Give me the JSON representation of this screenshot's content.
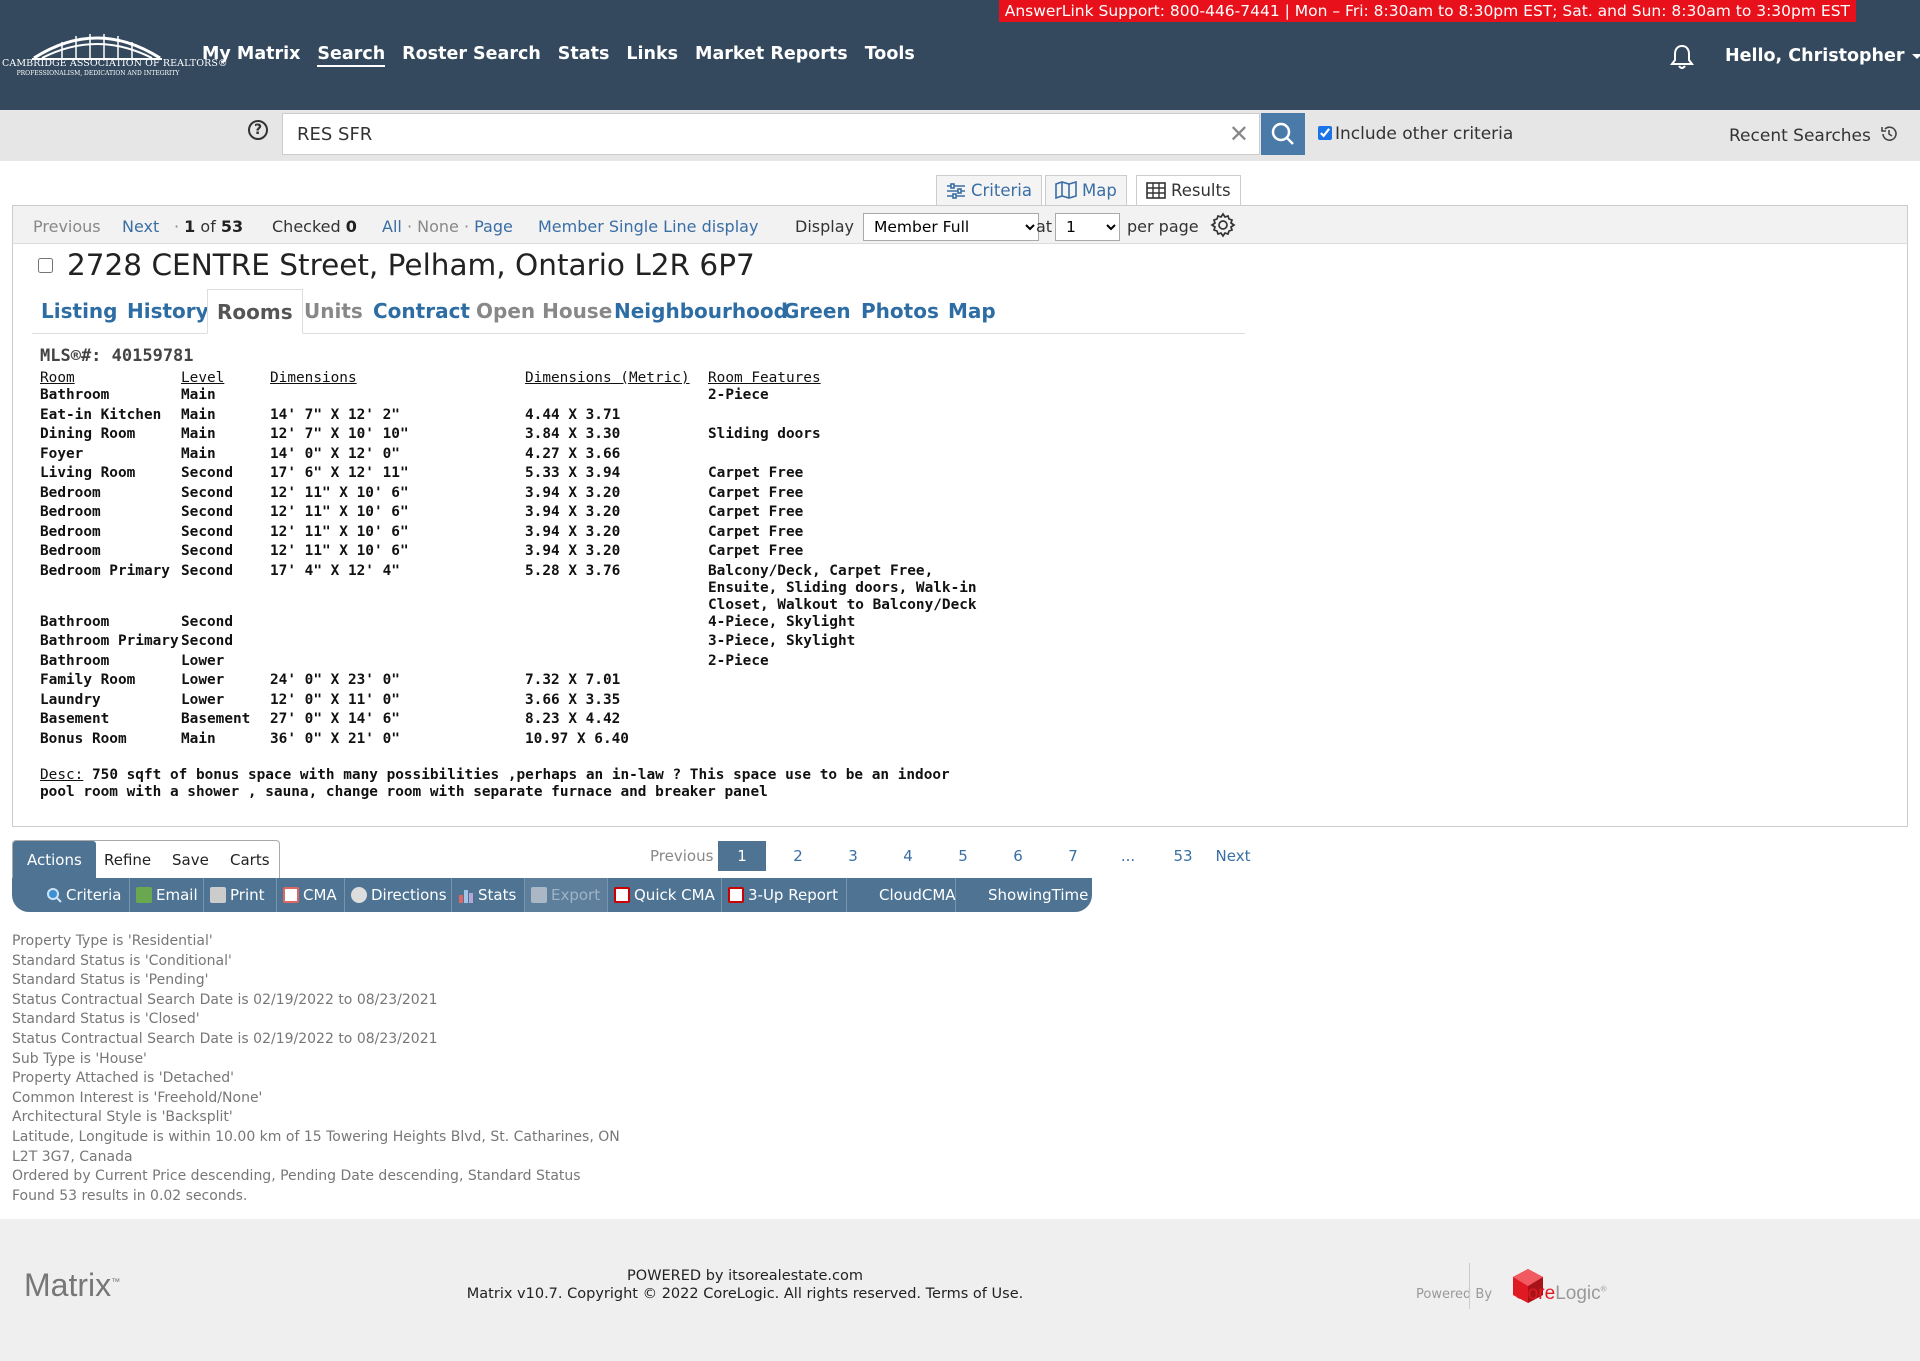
{
  "header": {
    "support_banner": "AnswerLink Support: 800-446-7441 | Mon – Fri: 8:30am to 8:30pm EST; Sat. and Sun: 8:30am to 3:30pm EST",
    "logo_name": "CAMBRIDGE ASSOCIATION OF REALTORS®",
    "logo_tagline": "PROFESSIONALISM, DEDICATION AND INTEGRITY",
    "nav": [
      "My Matrix",
      "Search",
      "Roster Search",
      "Stats",
      "Links",
      "Market Reports",
      "Tools"
    ],
    "active_nav": "Search",
    "user_greeting": "Hello, Christopher"
  },
  "search": {
    "query": "RES SFR",
    "include_other_criteria_label": "Include other criteria",
    "include_other_criteria_checked": true,
    "recent_searches_label": "Recent Searches"
  },
  "view_tabs": [
    {
      "label": "Criteria",
      "icon": "sliders-icon"
    },
    {
      "label": "Map",
      "icon": "map-icon"
    },
    {
      "label": "Results",
      "icon": "grid-icon",
      "active": true
    }
  ],
  "toolbar": {
    "previous": "Previous",
    "next": "Next",
    "position": "1",
    "of_label": "of",
    "total": "53",
    "checked_label": "Checked",
    "checked_count": "0",
    "all": "All",
    "none": "None",
    "page": "Page",
    "single_line": "Member Single Line display",
    "display_label": "Display",
    "display_value": "Member Full",
    "at_label": "at",
    "per_page_value": "1",
    "per_page_label": "per page"
  },
  "listing": {
    "address": "2728 CENTRE Street, Pelham, Ontario L2R 6P7",
    "tabs": [
      "Listing",
      "History",
      "Rooms",
      "Units",
      "Contract",
      "Open House",
      "Neighbourhood",
      "Green",
      "Photos",
      "Map"
    ],
    "active_tab": "Rooms",
    "disabled_tabs": [
      "Units",
      "Open House"
    ],
    "mls": "MLS®#: 40159781",
    "rooms_headers": [
      "Room",
      "Level",
      "Dimensions",
      "Dimensions (Metric)",
      "Room Features"
    ],
    "rooms": [
      [
        "Bathroom",
        "Main",
        "",
        "",
        "2-Piece"
      ],
      [
        "Eat-in Kitchen",
        "Main",
        "14' 7\" X 12' 2\"",
        "4.44 X 3.71",
        ""
      ],
      [
        "Dining Room",
        "Main",
        "12' 7\" X 10' 10\"",
        "3.84 X 3.30",
        "Sliding doors"
      ],
      [
        "Foyer",
        "Main",
        "14' 0\" X 12' 0\"",
        "4.27 X 3.66",
        ""
      ],
      [
        "Living Room",
        "Second",
        "17' 6\" X 12' 11\"",
        "5.33 X 3.94",
        "Carpet Free"
      ],
      [
        "Bedroom",
        "Second",
        "12' 11\" X 10' 6\"",
        "3.94 X 3.20",
        "Carpet Free"
      ],
      [
        "Bedroom",
        "Second",
        "12' 11\" X 10' 6\"",
        "3.94 X 3.20",
        "Carpet Free"
      ],
      [
        "Bedroom",
        "Second",
        "12' 11\" X 10' 6\"",
        "3.94 X 3.20",
        "Carpet Free"
      ],
      [
        "Bedroom",
        "Second",
        "12' 11\" X 10' 6\"",
        "3.94 X 3.20",
        "Carpet Free"
      ],
      [
        "Bedroom Primary",
        "Second",
        "17' 4\" X 12' 4\"",
        "5.28 X 3.76",
        "Balcony/Deck, Carpet Free, Ensuite, Sliding doors, Walk-in Closet, Walkout to Balcony/Deck"
      ],
      [
        "Bathroom",
        "Second",
        "",
        "",
        "4-Piece, Skylight"
      ],
      [
        "Bathroom Primary",
        "Second",
        "",
        "",
        "3-Piece, Skylight"
      ],
      [
        "Bathroom",
        "Lower",
        "",
        "",
        "2-Piece"
      ],
      [
        "Family Room",
        "Lower",
        "24' 0\" X 23' 0\"",
        "7.32 X 7.01",
        ""
      ],
      [
        "Laundry",
        "Lower",
        "12' 0\" X 11' 0\"",
        "3.66 X 3.35",
        ""
      ],
      [
        "Basement",
        "Basement",
        "27' 0\" X 14' 6\"",
        "8.23 X 4.42",
        ""
      ],
      [
        "Bonus Room",
        "Main",
        "36' 0\" X 21' 0\"",
        "10.97 X 6.40",
        ""
      ]
    ],
    "desc_label": "Desc:",
    "desc_text": " 750 sqft of bonus space with many possibilities ,perhaps an in-law ? This space use to be an indoor pool room with a shower , sauna, change room with separate furnace and breaker panel"
  },
  "action_tabs": [
    "Actions",
    "Refine",
    "Save",
    "Carts"
  ],
  "actions": [
    {
      "label": "Criteria",
      "icon": "search-icon",
      "color": "#3a8fd6"
    },
    {
      "label": "Email",
      "icon": "email-icon",
      "color": "#6aa84f"
    },
    {
      "label": "Print",
      "icon": "print-icon",
      "color": "#cccccc"
    },
    {
      "label": "CMA",
      "icon": "cma-icon",
      "color": "#e06666"
    },
    {
      "label": "Directions",
      "icon": "compass-icon",
      "color": "#dddddd"
    },
    {
      "label": "Stats",
      "icon": "stats-icon",
      "color": "#9fc5e8"
    },
    {
      "label": "Export",
      "icon": "export-icon",
      "color": "#aab8c5",
      "disabled": true
    },
    {
      "label": "Quick CMA",
      "icon": "quick-cma-icon",
      "color": "#cc0000"
    },
    {
      "label": "3-Up Report",
      "icon": "report-icon",
      "color": "#cc0000"
    },
    {
      "label": "CloudCMA",
      "icon": "",
      "color": ""
    },
    {
      "label": "ShowingTime",
      "icon": "",
      "color": ""
    }
  ],
  "pager": {
    "previous": "Previous",
    "pages": [
      "1",
      "2",
      "3",
      "4",
      "5",
      "6",
      "7",
      "...",
      "53"
    ],
    "current": "1",
    "next": "Next"
  },
  "criteria_summary": [
    "Property Type is 'Residential'",
    "Standard Status is 'Conditional'",
    "Standard Status is 'Pending'",
    "Status Contractual Search Date is 02/19/2022 to 08/23/2021",
    "Standard Status is 'Closed'",
    "Status Contractual Search Date is 02/19/2022 to 08/23/2021",
    "Sub Type is 'House'",
    "Property Attached is 'Detached'",
    "Common Interest is 'Freehold/None'",
    "Architectural Style is 'Backsplit'",
    "Latitude, Longitude is within 10.00 km of 15 Towering Heights Blvd, St. Catharines, ON",
    "L2T 3G7, Canada",
    "Ordered by Current Price descending, Pending Date descending, Standard Status",
    "Found 53 results in 0.02 seconds."
  ],
  "footer": {
    "logo": "Matrix",
    "logo_tm": "™",
    "powered_line": "POWERED by itsorealestate.com",
    "copyright": "Matrix v10.7. Copyright © 2022 CoreLogic. All rights reserved. Terms of Use.",
    "powered_by": "Powered By",
    "corelogic_core": "Core",
    "corelogic_logic": "Logic",
    "corelogic_reg": "®"
  },
  "colors": {
    "header_bg": "#34495e",
    "banner_bg": "#e8101a",
    "accent": "#4e7393",
    "link": "#3a6ea5"
  }
}
